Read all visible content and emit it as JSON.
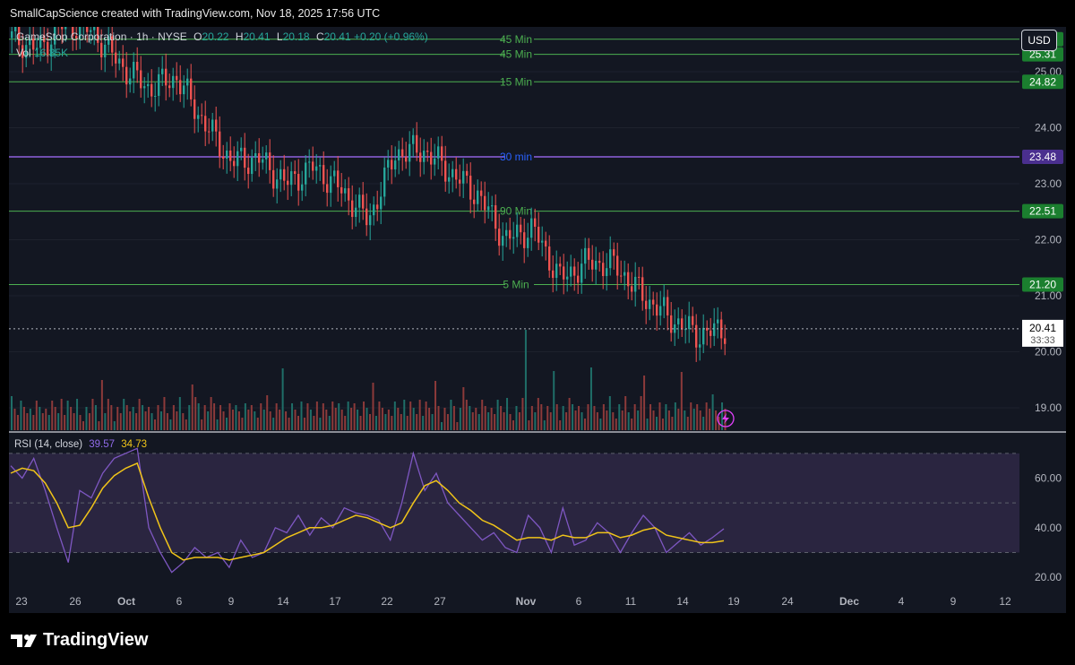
{
  "header": {
    "text": "SmallCapScience created with TradingView.com, Nov 18, 2025 17:56 UTC"
  },
  "legend": {
    "symbol": "GameStop Corporation · 1h · NYSE",
    "o_label": "O",
    "o": "20.22",
    "h_label": "H",
    "h": "20.41",
    "l_label": "L",
    "l": "20.18",
    "c_label": "C",
    "c": "20.41",
    "change": "+0.20 (+0.96%)",
    "vol_label": "Vol",
    "vol": "16.35K"
  },
  "rsi_legend": {
    "label": "RSI (14, close)",
    "rsi": "39.57",
    "ma": "34.73"
  },
  "currency_button": "USD",
  "brand": {
    "name": "TradingView"
  },
  "colors": {
    "bg": "#131722",
    "up": "#26a69a",
    "down": "#ef5350",
    "level": "#4caf50",
    "purple_level": "#7e57c2",
    "rsi": "#7e57c2",
    "rsi_ma": "#f0c419"
  },
  "chart_data": {
    "type": "candlestick",
    "price_axis": {
      "ticks": [
        19.0,
        20.0,
        21.0,
        22.0,
        23.0,
        24.0,
        25.0
      ],
      "tick_labels": [
        "19.00",
        "20.00",
        "21.00",
        "22.00",
        "23.00",
        "24.00",
        "25.00"
      ],
      "range": [
        18.6,
        25.8
      ]
    },
    "x_axis": {
      "labels": [
        "23",
        "26",
        "Oct",
        "6",
        "9",
        "14",
        "17",
        "22",
        "27",
        "Nov",
        "6",
        "11",
        "14",
        "19",
        "24",
        "Dec",
        "4",
        "9",
        "12"
      ],
      "bold_labels": [
        "Oct",
        "Nov",
        "Dec"
      ]
    },
    "levels": [
      {
        "label": "45 Min",
        "value": 25.58,
        "price_label": "25.58",
        "color": "green"
      },
      {
        "label": "45 Min",
        "value": 25.31,
        "price_label": "25.31",
        "color": "green"
      },
      {
        "label": "15 Min",
        "value": 24.82,
        "price_label": "24.82",
        "color": "green"
      },
      {
        "label": "30 min",
        "value": 23.48,
        "price_label": "23.48",
        "color": "purple"
      },
      {
        "label": "90 Min",
        "value": 22.51,
        "price_label": "22.51",
        "color": "green"
      },
      {
        "label": "5 Min",
        "value": 21.2,
        "price_label": "21.20",
        "color": "green"
      }
    ],
    "last_price": {
      "value": 20.41,
      "label": "20.41",
      "countdown": "33:33"
    },
    "price_path": [
      {
        "day": "Sep 23",
        "price": 25.6
      },
      {
        "day": "Sep 26",
        "price": 25.4
      },
      {
        "day": "Oct 1",
        "price": 25.9
      },
      {
        "day": "Oct 6",
        "price": 25.7
      },
      {
        "day": "Oct 7",
        "price": 25.1
      },
      {
        "day": "Oct 8",
        "price": 24.7
      },
      {
        "day": "Oct 9",
        "price": 24.9
      },
      {
        "day": "Oct 10",
        "price": 24.1
      },
      {
        "day": "Oct 13",
        "price": 23.4
      },
      {
        "day": "Oct 15",
        "price": 23.45
      },
      {
        "day": "Oct 17",
        "price": 23.0
      },
      {
        "day": "Oct 20",
        "price": 23.3
      },
      {
        "day": "Oct 21",
        "price": 22.9
      },
      {
        "day": "Oct 22",
        "price": 22.35
      },
      {
        "day": "Oct 24",
        "price": 23.55
      },
      {
        "day": "Oct 27",
        "price": 23.6
      },
      {
        "day": "Oct 29",
        "price": 23.2
      },
      {
        "day": "Oct 31",
        "price": 22.8
      },
      {
        "day": "Nov 3",
        "price": 22.0
      },
      {
        "day": "Nov 5",
        "price": 22.2
      },
      {
        "day": "Nov 7",
        "price": 21.3
      },
      {
        "day": "Nov 10",
        "price": 21.6
      },
      {
        "day": "Nov 12",
        "price": 21.55
      },
      {
        "day": "Nov 13",
        "price": 21.0
      },
      {
        "day": "Nov 14",
        "price": 20.6
      },
      {
        "day": "Nov 17",
        "price": 20.3
      },
      {
        "day": "Nov 18",
        "price": 20.41
      }
    ],
    "rsi": {
      "ticks": [
        20.0,
        40.0,
        60.0
      ],
      "tick_labels": [
        "20.00",
        "40.00",
        "60.00"
      ],
      "bands": [
        30,
        50,
        70
      ],
      "range": [
        15,
        75
      ],
      "rsi_path": [
        65,
        60,
        68,
        55,
        40,
        26,
        55,
        52,
        62,
        68,
        70,
        72,
        40,
        30,
        22,
        26,
        32,
        28,
        30,
        24,
        35,
        28,
        30,
        40,
        38,
        45,
        37,
        44,
        40,
        48,
        46,
        45,
        43,
        35,
        50,
        70,
        55,
        62,
        50,
        45,
        40,
        35,
        38,
        32,
        30,
        45,
        40,
        30,
        48,
        33,
        35,
        42,
        38,
        30,
        38,
        45,
        40,
        30,
        34,
        38,
        33,
        36,
        39.57
      ],
      "ma_path": [
        62,
        64,
        63,
        58,
        50,
        40,
        41,
        48,
        56,
        61,
        64,
        66,
        52,
        40,
        30,
        27,
        28,
        28,
        28,
        27,
        28,
        29,
        30,
        33,
        36,
        38,
        40,
        40,
        41,
        43,
        45,
        44,
        42,
        40,
        42,
        50,
        57,
        59,
        55,
        50,
        47,
        43,
        41,
        38,
        35,
        36,
        36,
        35,
        37,
        36,
        36,
        38,
        38,
        36,
        37,
        39,
        40,
        37,
        36,
        35,
        34,
        34,
        34.73
      ]
    },
    "volume": {
      "last_label": "16.35K"
    }
  }
}
